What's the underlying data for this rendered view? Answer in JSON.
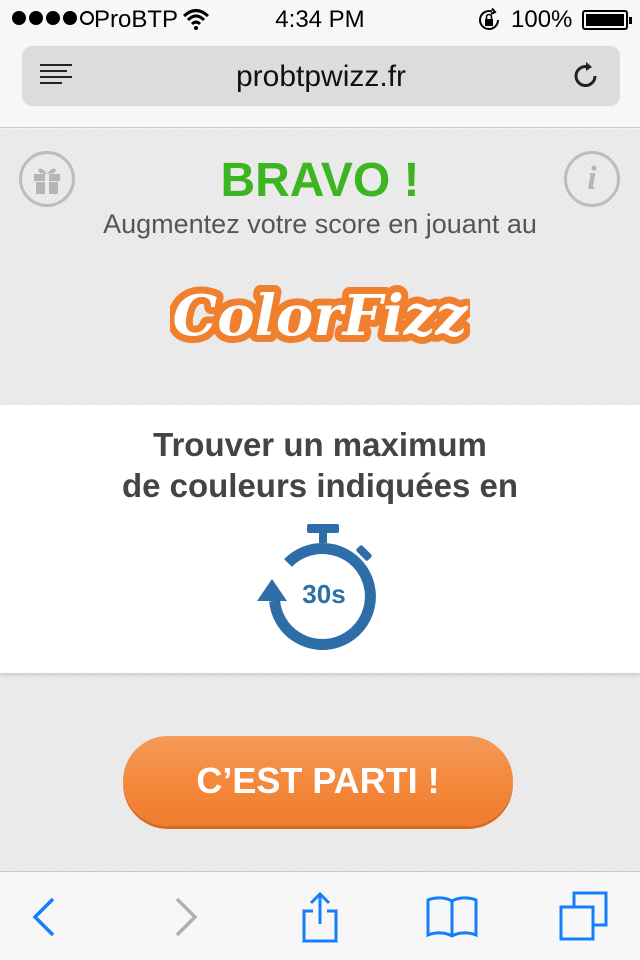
{
  "status_bar": {
    "carrier": "ProBTP",
    "time": "4:34 PM",
    "battery": "100%"
  },
  "browser": {
    "url": "probtpwizz.fr"
  },
  "page": {
    "heading": "BRAVO !",
    "subtitle": "Augmentez votre score en jouant au",
    "game_logo": "ColorFizz",
    "instruction_line1": "Trouver un maximum",
    "instruction_line2": "de couleurs indiquées en",
    "timer": "30s",
    "start_button": "C’EST PARTI !"
  },
  "colors": {
    "heading_green": "#3cb521",
    "button_orange": "#f48a3e",
    "timer_blue": "#2d6da8",
    "ios_blue": "#147efb"
  },
  "icons": {
    "gift": "gift-icon",
    "info": "info-icon",
    "reader": "reader-icon",
    "reload": "reload-icon",
    "back": "back-icon",
    "forward": "forward-icon",
    "share": "share-icon",
    "bookmarks": "bookmarks-icon",
    "tabs": "tabs-icon"
  }
}
